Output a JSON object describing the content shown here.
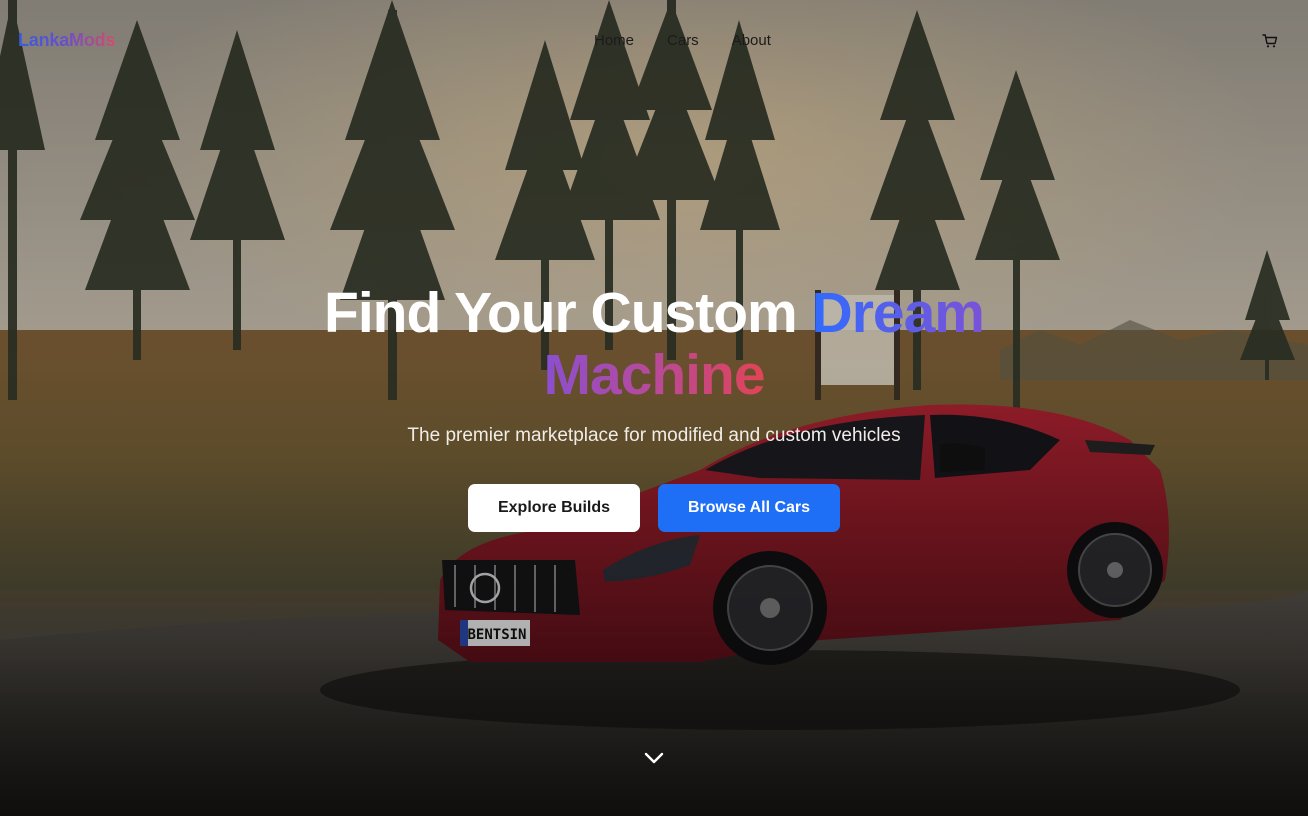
{
  "nav": {
    "logo": "LankaMods",
    "links": [
      "Home",
      "Cars",
      "About"
    ],
    "cart_icon": "cart-icon"
  },
  "hero": {
    "headline_white": "Find Your Custom ",
    "headline_accent_1": "Dream",
    "headline_accent_2": "Machine",
    "subtitle": "The premier marketplace for modified and custom vehicles",
    "primary_button": "Explore Builds",
    "secondary_button": "Browse All Cars",
    "scroll_icon": "chevron-down-icon",
    "plate_text": "BENTSIN"
  },
  "colors": {
    "accent_blue": "#1e6ff5",
    "gradient_start": "#2f6bff",
    "gradient_mid": "#8a4fd0",
    "gradient_end": "#e14455"
  }
}
